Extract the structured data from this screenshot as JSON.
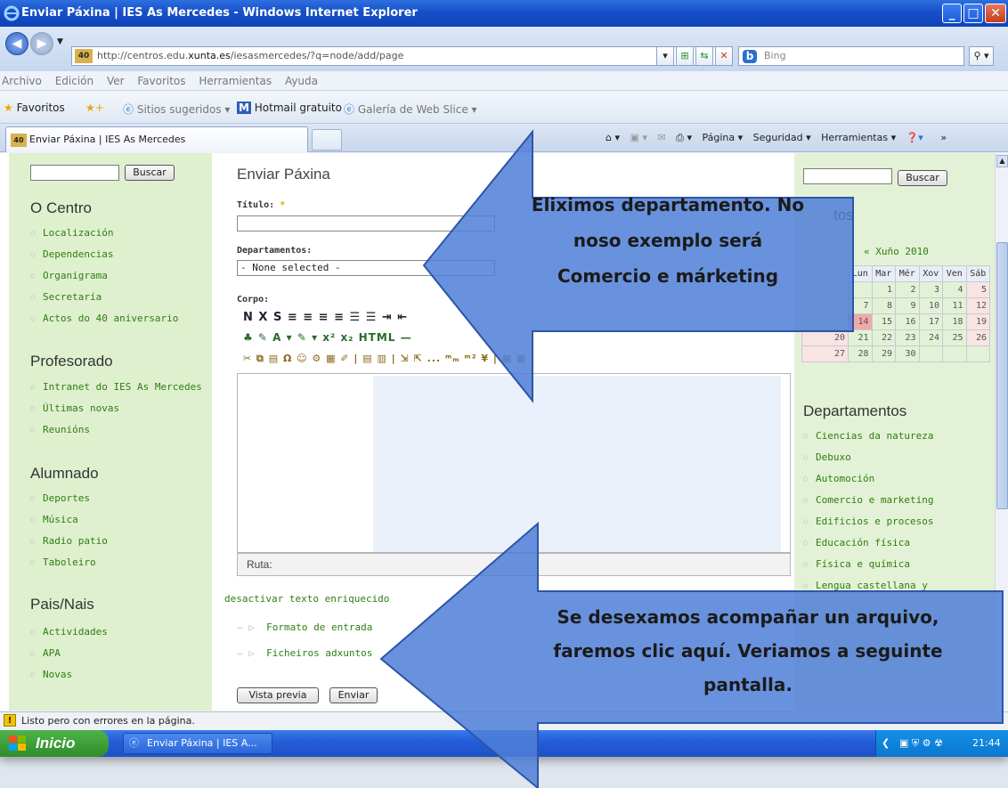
{
  "window": {
    "title": "Enviar Páxina | IES As Mercedes - Windows Internet Explorer"
  },
  "address": {
    "url_pre": "http://centros.edu.",
    "url_domain": "xunta.es",
    "url_post": "/iesasmercedes/?q=node/add/page",
    "search_placeholder": "Bing",
    "favicon_text": "40"
  },
  "menu": [
    "Archivo",
    "Edición",
    "Ver",
    "Favoritos",
    "Herramientas",
    "Ayuda"
  ],
  "favbar": {
    "favoritos": "Favoritos",
    "sitios": "Sitios sugeridos ▾",
    "hotmail": "Hotmail gratuito",
    "galeria": "Galería de Web Slice ▾"
  },
  "tab": {
    "title": "Enviar Páxina | IES As Mercedes"
  },
  "cmdbar": {
    "pagina": "Página ▾",
    "seguridad": "Seguridad ▾",
    "herramientas": "Herramientas ▾",
    "more": "»"
  },
  "left": {
    "search_button": "Buscar",
    "sections": [
      {
        "title": "O Centro",
        "items": [
          "Localización",
          "Dependencias",
          "Organigrama",
          "Secretaría",
          "Actos do 40 aniversario"
        ]
      },
      {
        "title": "Profesorado",
        "items": [
          "Intranet do IES As Mercedes",
          "Últimas novas",
          "Reunións"
        ]
      },
      {
        "title": "Alumnado",
        "items": [
          "Deportes",
          "Música",
          "Radio patio",
          "Taboleiro"
        ]
      },
      {
        "title": "Pais/Nais",
        "items": [
          "Actividades",
          "APA",
          "Novas"
        ]
      }
    ]
  },
  "main": {
    "title": "Enviar Páxina",
    "titulo_label": "Título:",
    "required_mark": "*",
    "departamentos_label": "Departamentos:",
    "departamentos_value": "- None selected -",
    "corpo_label": "Corpo:",
    "toolbar_row1": "N  X  S  ≡  ≡  ≡  ≡  ☰  ☰  ⇥  ⇤",
    "toolbar_row2": "♣  ✎  A ▾  ✎ ▾  x²  x₂  HTML  —",
    "toolbar_row3": "✂  ⧉  ▤  Ω  ☺  ⚙  ▦  ✐  |  ▤  ▥  |  ⇲  ⇱  ...  ᵐₘ  ᵐ²  ¥  |  ▦  ▦",
    "ruta_label": "Ruta:",
    "rich_text_link": "desactivar texto enriquecido",
    "formato": "Formato de entrada",
    "ficheiros": "Ficheiros adxuntos",
    "preview_button": "Vista previa",
    "submit_button": "Enviar"
  },
  "right": {
    "search_button": "Buscar",
    "events_title_partial": "tos",
    "calendar_title": "« Xuño 2010",
    "calendar_headers": [
      "Lun",
      "Mar",
      "Mér",
      "Xov",
      "Ven",
      "Sáb"
    ],
    "calendar_rows": [
      [
        "",
        "1",
        "2",
        "3",
        "4",
        "5"
      ],
      [
        "7",
        "8",
        "9",
        "10",
        "11",
        "12"
      ],
      [
        "14",
        "15",
        "16",
        "17",
        "18",
        "19"
      ],
      [
        "20",
        "21",
        "22",
        "23",
        "24",
        "25",
        "26"
      ],
      [
        "27",
        "28",
        "29",
        "30",
        "",
        ""
      ]
    ],
    "departamentos_title": "Departamentos",
    "departamentos": [
      "Ciencias da natureza",
      "Debuxo",
      "Automoción",
      "Comercio e marketing",
      "Edificios e procesos",
      "Educación física",
      "Física e química",
      "Lengua castellana y"
    ]
  },
  "status": {
    "text": "Listo pero con errores en la página."
  },
  "taskbar": {
    "start": "Inicio",
    "task": "Enviar Páxina | IES A...",
    "clock": "21:44"
  },
  "callouts": {
    "top": [
      "Eliximos departamento. No",
      "noso exemplo será",
      "Comercio e márketing"
    ],
    "bottom": [
      "Se desexamos acompañar un arquivo,",
      "faremos clic aquí. Veriamos a seguinte",
      "pantalla."
    ]
  },
  "colors": {
    "accent": "#1650c9",
    "sidebar_green": "#dff0cf",
    "link_green": "#2f7d12",
    "arrow_blue": "#4f7fd8"
  }
}
